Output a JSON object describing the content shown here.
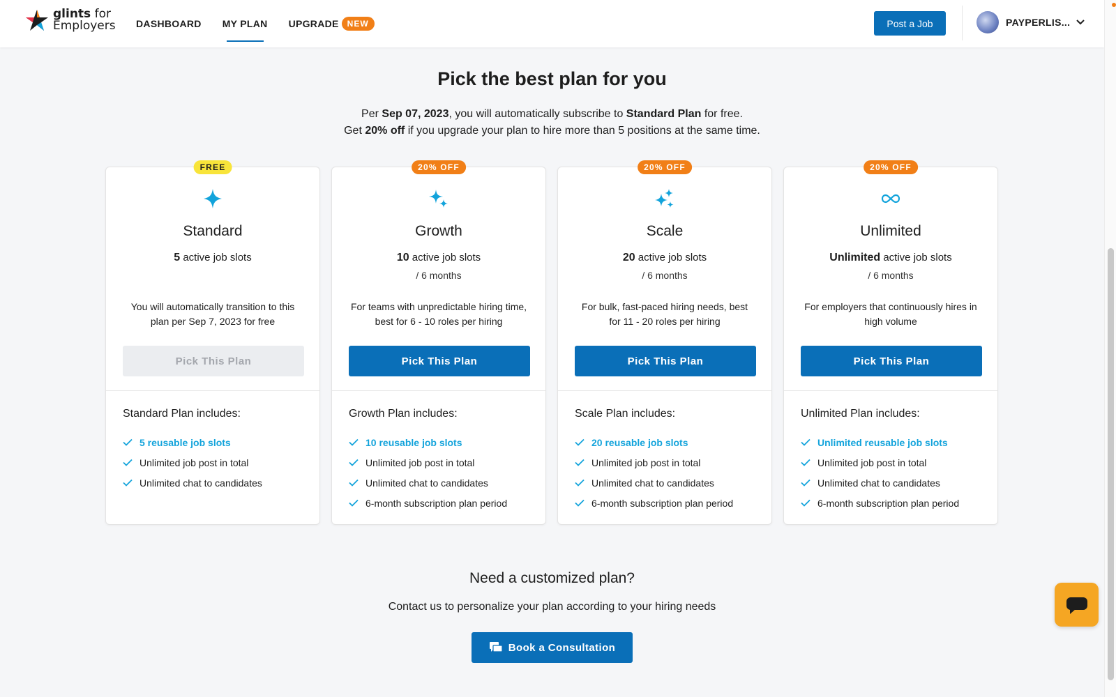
{
  "header": {
    "logo_brand": "glints",
    "logo_for": "for",
    "logo_sub": "Employers",
    "nav": [
      {
        "label": "DASHBOARD"
      },
      {
        "label": "MY PLAN"
      },
      {
        "label": "UPGRADE"
      }
    ],
    "new_badge": "NEW",
    "post_job_label": "Post a Job",
    "user_name": "PAYPERLIS..."
  },
  "hero": {
    "title": "Pick the best plan for you",
    "line1_a": "Per ",
    "line1_date": "Sep 07, 2023",
    "line1_b": ", you will automatically subscribe to ",
    "line1_plan": "Standard Plan",
    "line1_c": " for free.",
    "line2_a": "Get ",
    "line2_pct": "20% off",
    "line2_b": " if you upgrade your plan to hire more than 5 positions at the same time."
  },
  "plans": [
    {
      "badge": "FREE",
      "name": "Standard",
      "slots_num": "5",
      "slots_text": " active job slots",
      "period": "",
      "desc": "You will automatically transition to this plan per Sep 7, 2023 for free",
      "button": "Pick This Plan",
      "includes_title": "Standard Plan includes:",
      "includes": [
        "5 reusable job slots",
        "Unlimited job post in total",
        "Unlimited chat to candidates"
      ]
    },
    {
      "badge": "20% OFF",
      "name": "Growth",
      "slots_num": "10",
      "slots_text": " active job slots",
      "period": "/ 6 months",
      "desc": "For teams with unpredictable hiring time, best for 6 - 10 roles per hiring",
      "button": "Pick This Plan",
      "includes_title": "Growth Plan includes:",
      "includes": [
        "10 reusable job slots",
        "Unlimited job post in total",
        "Unlimited chat to candidates",
        "6-month subscription plan period"
      ]
    },
    {
      "badge": "20% OFF",
      "name": "Scale",
      "slots_num": "20",
      "slots_text": " active job slots",
      "period": "/ 6 months",
      "desc": "For bulk, fast-paced hiring needs, best for 11 - 20 roles per hiring",
      "button": "Pick This Plan",
      "includes_title": "Scale Plan includes:",
      "includes": [
        "20 reusable job slots",
        "Unlimited job post in total",
        "Unlimited chat to candidates",
        "6-month subscription plan period"
      ]
    },
    {
      "badge": "20% OFF",
      "name": "Unlimited",
      "slots_num": "Unlimited",
      "slots_text": " active job slots",
      "period": "/ 6 months",
      "desc": "For employers that continuously hires in high volume",
      "button": "Pick This Plan",
      "includes_title": "Unlimited Plan includes:",
      "includes": [
        "Unlimited reusable job slots",
        "Unlimited job post in total",
        "Unlimited chat to candidates",
        "6-month subscription plan period"
      ]
    }
  ],
  "custom": {
    "title": "Need a customized plan?",
    "subtitle": "Contact us to personalize your plan according to your hiring needs",
    "button": "Book a Consultation"
  },
  "colors": {
    "primary": "#0a6fb8",
    "accent_orange": "#f17f17",
    "highlight_blue": "#12a3db",
    "free_yellow": "#f8e43a",
    "chat_fab": "#f5a623"
  },
  "icons": {
    "standard": "sparkle-icon",
    "growth": "sparkles-icon",
    "scale": "sparkles-multi-icon",
    "unlimited": "infinity-icon",
    "check": "check-icon",
    "chat": "chat-bubble-icon"
  }
}
